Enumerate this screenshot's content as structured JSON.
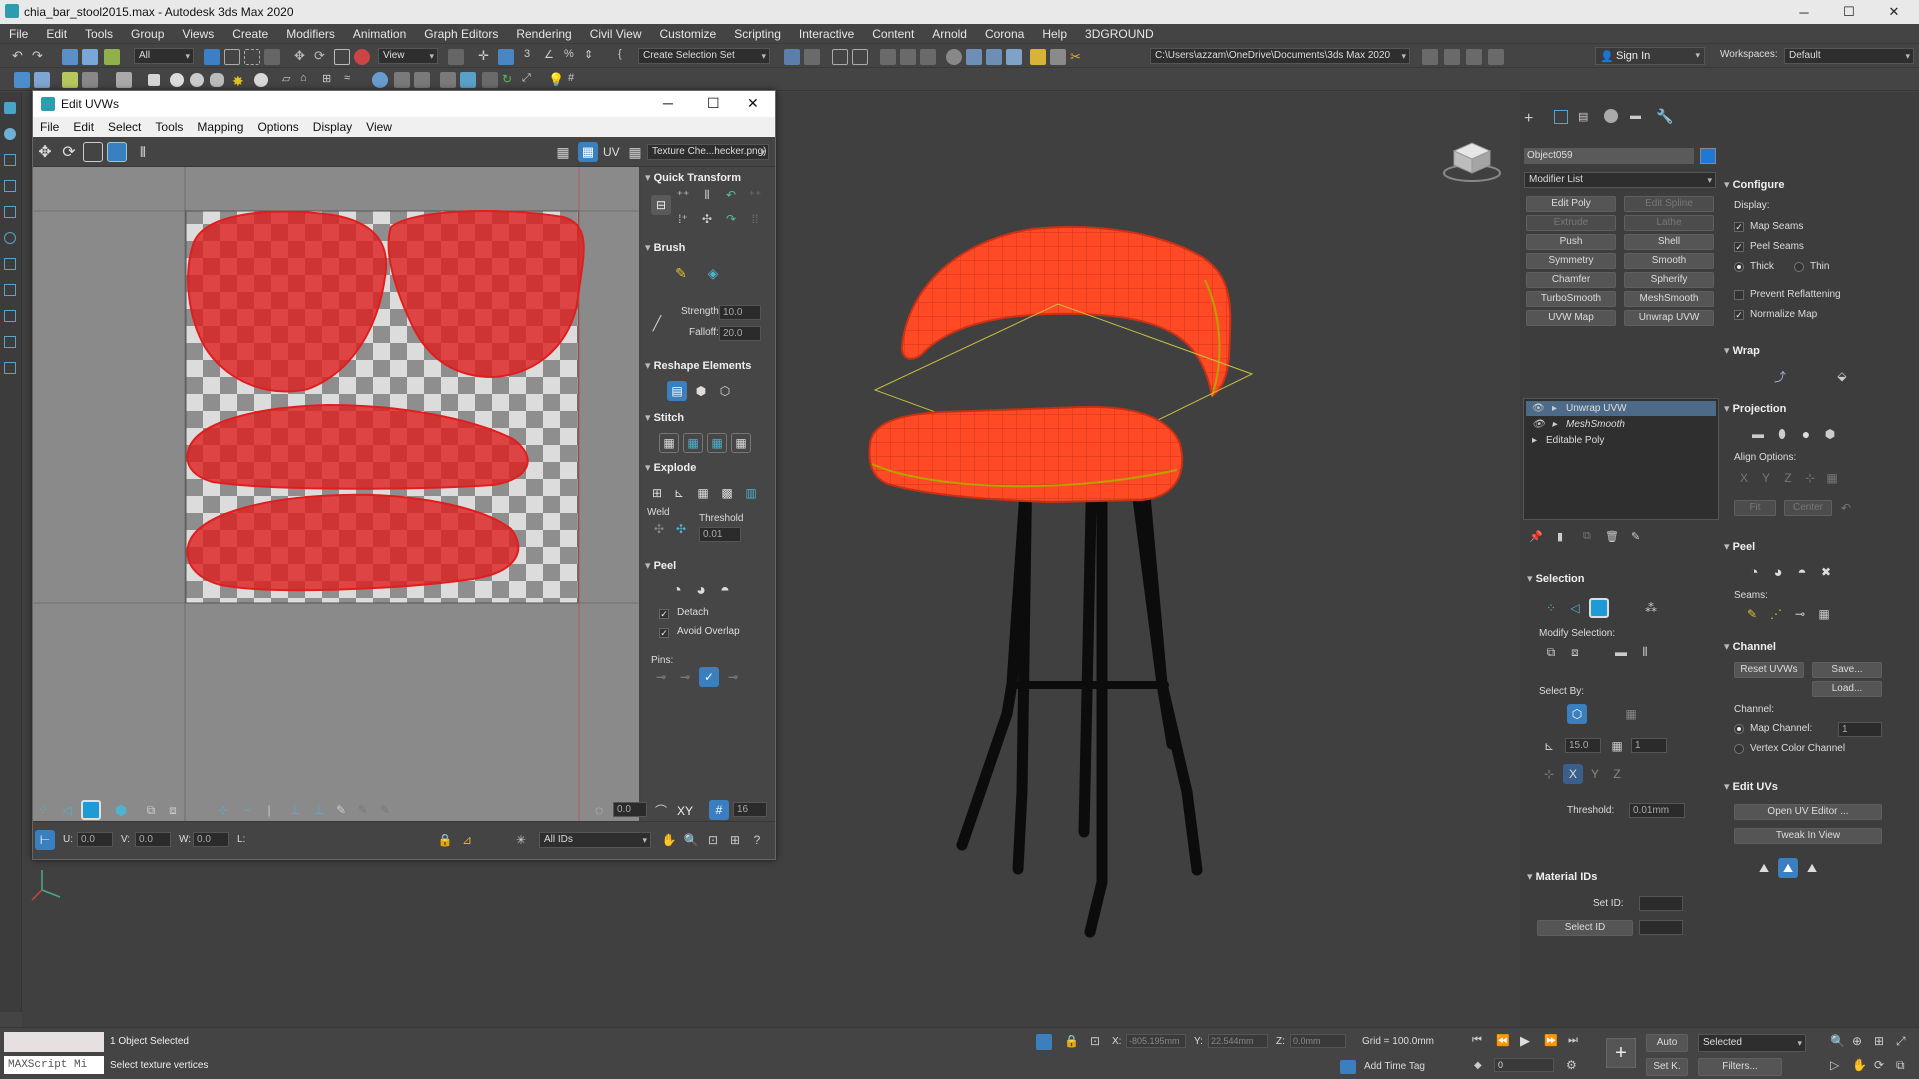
{
  "window": {
    "title": "chia_bar_stool2015.max - Autodesk 3ds Max 2020",
    "minimize": "─",
    "maximize": "☐",
    "close": "✕"
  },
  "menubar": [
    "File",
    "Edit",
    "Tools",
    "Group",
    "Views",
    "Create",
    "Modifiers",
    "Animation",
    "Graph Editors",
    "Rendering",
    "Civil View",
    "Customize",
    "Scripting",
    "Interactive",
    "Content",
    "Arnold",
    "Corona",
    "Help",
    "3DGROUND"
  ],
  "toolbar": {
    "selection_filter": "All",
    "ref_coord": "View",
    "selection_set": "Create Selection Set",
    "project_path": "C:\\Users\\azzam\\OneDrive\\Documents\\3ds Max 2020",
    "sign_in": "Sign In",
    "workspaces_label": "Workspaces:",
    "workspace_value": "Default"
  },
  "uv_editor": {
    "title": "Edit UVWs",
    "menu": [
      "File",
      "Edit",
      "Select",
      "Tools",
      "Mapping",
      "Options",
      "Display",
      "View"
    ],
    "uv_label": "UV",
    "texture_dropdown": "Texture Che...hecker.png)",
    "panel": {
      "quick_transform": "Quick Transform",
      "brush": "Brush",
      "strength_label": "Strength:",
      "strength_value": "10.0",
      "falloff_label": "Falloff:",
      "falloff_value": "20.0",
      "reshape": "Reshape Elements",
      "stitch": "Stitch",
      "explode": "Explode",
      "weld_label": "Weld",
      "threshold_label": "Threshold",
      "threshold_value": "0.01",
      "peel": "Peel",
      "detach": "Detach",
      "avoid_overlap": "Avoid Overlap",
      "pins": "Pins:"
    },
    "bottom": {
      "angle_value": "0.0",
      "xy_label": "XY",
      "grid_value": "16",
      "u_label": "U:",
      "u_value": "0.0",
      "v_label": "V:",
      "v_value": "0.0",
      "w_label": "W:",
      "w_value": "0.0",
      "l_label": "L:",
      "ids_dropdown": "All IDs"
    }
  },
  "command_panel": {
    "object_name": "Object059",
    "object_color": "#1e78d8",
    "modifier_list": "Modifier List",
    "modifier_buttons": [
      {
        "label": "Edit Poly",
        "enabled": true
      },
      {
        "label": "Edit Spline",
        "enabled": false
      },
      {
        "label": "Extrude",
        "enabled": false
      },
      {
        "label": "Lathe",
        "enabled": false
      },
      {
        "label": "Push",
        "enabled": true
      },
      {
        "label": "Shell",
        "enabled": true
      },
      {
        "label": "Symmetry",
        "enabled": true
      },
      {
        "label": "Smooth",
        "enabled": true
      },
      {
        "label": "Chamfer",
        "enabled": true
      },
      {
        "label": "Spherify",
        "enabled": true
      },
      {
        "label": "TurboSmooth",
        "enabled": true
      },
      {
        "label": "MeshSmooth",
        "enabled": true
      },
      {
        "label": "UVW Map",
        "enabled": true
      },
      {
        "label": "Unwrap UVW",
        "enabled": true
      }
    ],
    "stack": [
      "Unwrap UVW",
      "MeshSmooth",
      "Editable Poly"
    ],
    "selection_header": "Selection",
    "modify_selection": "Modify Selection:",
    "select_by": "Select By:",
    "angle_value": "15.0",
    "grow_value": "1",
    "threshold_label": "Threshold:",
    "threshold_value": "0.01mm",
    "material_ids": "Material IDs",
    "set_id_label": "Set ID:",
    "select_id": "Select ID",
    "configure": "Configure",
    "display_label": "Display:",
    "map_seams": "Map Seams",
    "peel_seams": "Peel Seams",
    "thick": "Thick",
    "thin": "Thin",
    "prevent_reflattening": "Prevent Reflattening",
    "normalize_map": "Normalize Map",
    "wrap": "Wrap",
    "projection": "Projection",
    "align_options": "Align Options:",
    "fit": "Fit",
    "center": "Center",
    "peel": "Peel",
    "seams": "Seams:",
    "channel": "Channel",
    "reset_uvws": "Reset UVWs",
    "save": "Save...",
    "load": "Load...",
    "channel_label": "Channel:",
    "map_channel": "Map Channel:",
    "map_channel_value": "1",
    "vertex_color_channel": "Vertex Color Channel",
    "edit_uvs": "Edit UVs",
    "open_uv_editor": "Open UV Editor ...",
    "tweak_in_view": "Tweak In View"
  },
  "status": {
    "maxscript": "MAXScript Mi",
    "selected_text": "1 Object Selected",
    "prompt": "Select texture vertices",
    "x_label": "X:",
    "x_value": "-805.195mm",
    "y_label": "Y:",
    "y_value": "22.544mm",
    "z_label": "Z:",
    "z_value": "0.0mm",
    "grid": "Grid = 100.0mm",
    "add_time_tag": "Add Time Tag",
    "auto": "Auto",
    "selected_dropdown": "Selected",
    "setk": "Set K.",
    "filters": "Filters...",
    "frame_value": "0"
  },
  "colors": {
    "uv_shell": "#e01e1e",
    "mesh": "#ff4a25",
    "selection_panel_active": "#1e9ad6"
  }
}
